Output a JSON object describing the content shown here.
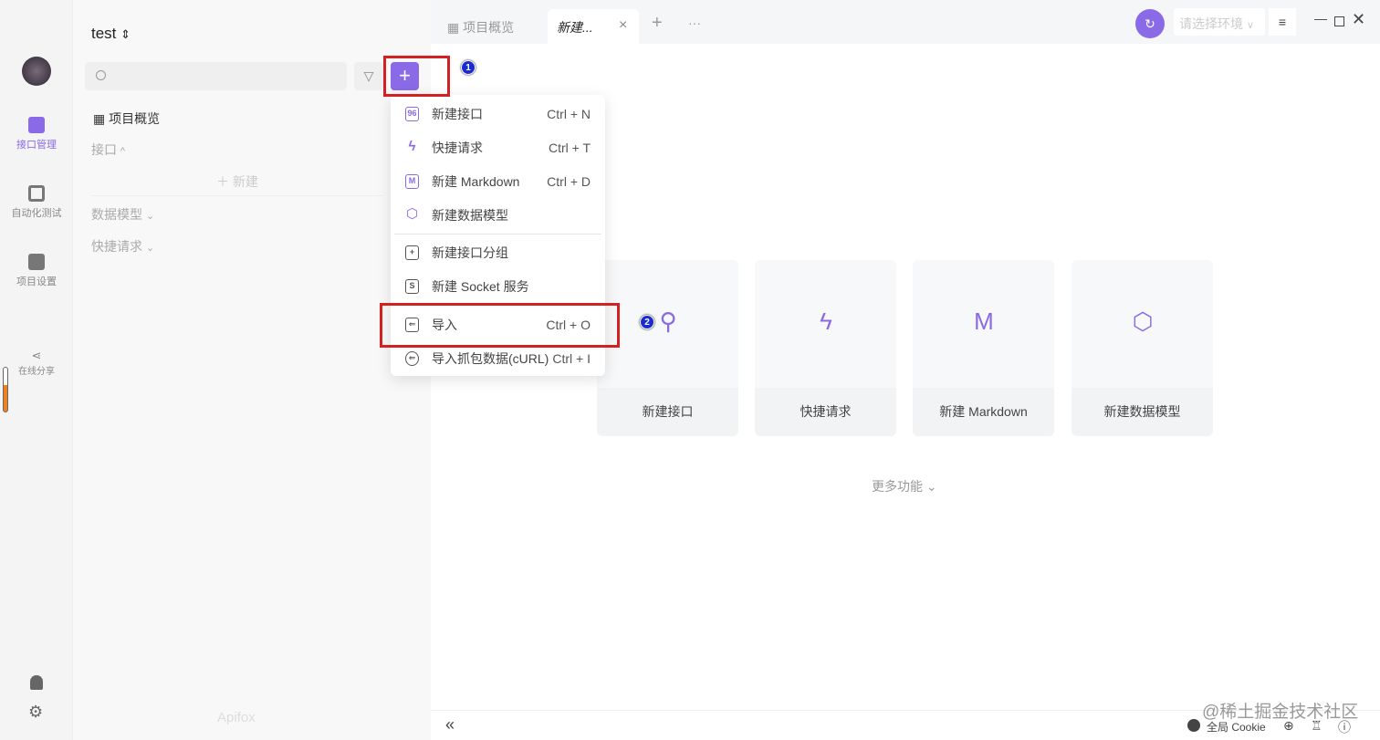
{
  "project": {
    "name": "test",
    "switch_icon": "chevron-updown-icon"
  },
  "rail": {
    "items": [
      {
        "label": "接口管理",
        "icon": "api-icon",
        "active": true
      },
      {
        "label": "自动化测试",
        "icon": "automation-icon"
      },
      {
        "label": "项目设置",
        "icon": "settings-icon"
      },
      {
        "label": "在线分享",
        "icon": "share-icon"
      }
    ]
  },
  "sidebar": {
    "overview": "项目概览",
    "sections": [
      {
        "label": "接口",
        "chevron": "^"
      },
      {
        "label": "数据模型",
        "chevron": "⌄"
      },
      {
        "label": "快捷请求",
        "chevron": "⌄"
      }
    ],
    "new_label": "＋ 新建",
    "brand": "Apifox"
  },
  "tabs": [
    {
      "label": "项目概览"
    },
    {
      "label": "新建..."
    }
  ],
  "env": {
    "placeholder": "请选择环境"
  },
  "menu": {
    "items": [
      {
        "label": "新建接口",
        "shortcut": "Ctrl + N",
        "icon": "96"
      },
      {
        "label": "快捷请求",
        "shortcut": "Ctrl + T",
        "icon": "ϟ"
      },
      {
        "label": "新建 Markdown",
        "shortcut": "Ctrl + D",
        "icon": "M"
      },
      {
        "label": "新建数据模型",
        "shortcut": "",
        "icon": "⬡"
      },
      {
        "label": "新建接口分组",
        "shortcut": "",
        "icon": "+"
      },
      {
        "label": "新建 Socket 服务",
        "shortcut": "",
        "icon": "S"
      },
      {
        "label": "导入",
        "shortcut": "Ctrl + O",
        "icon": "⇐"
      },
      {
        "label": "导入抓包数据(cURL)",
        "shortcut": "Ctrl + I",
        "icon": "⇐"
      }
    ]
  },
  "cards": [
    {
      "label": "新建接口",
      "icon": "⚲"
    },
    {
      "label": "快捷请求",
      "icon": "ϟ"
    },
    {
      "label": "新建 Markdown",
      "icon": "M"
    },
    {
      "label": "新建数据模型",
      "icon": "⬡"
    }
  ],
  "more": "更多功能 ⌄",
  "footer": {
    "cookie": "全局 Cookie",
    "watermark": "@稀土掘金技术社区",
    "collapse": "«"
  },
  "annotations": {
    "badge1": "1",
    "badge2": "2"
  },
  "colors": {
    "accent": "#8a6ae6",
    "highlight": "#d42020"
  }
}
